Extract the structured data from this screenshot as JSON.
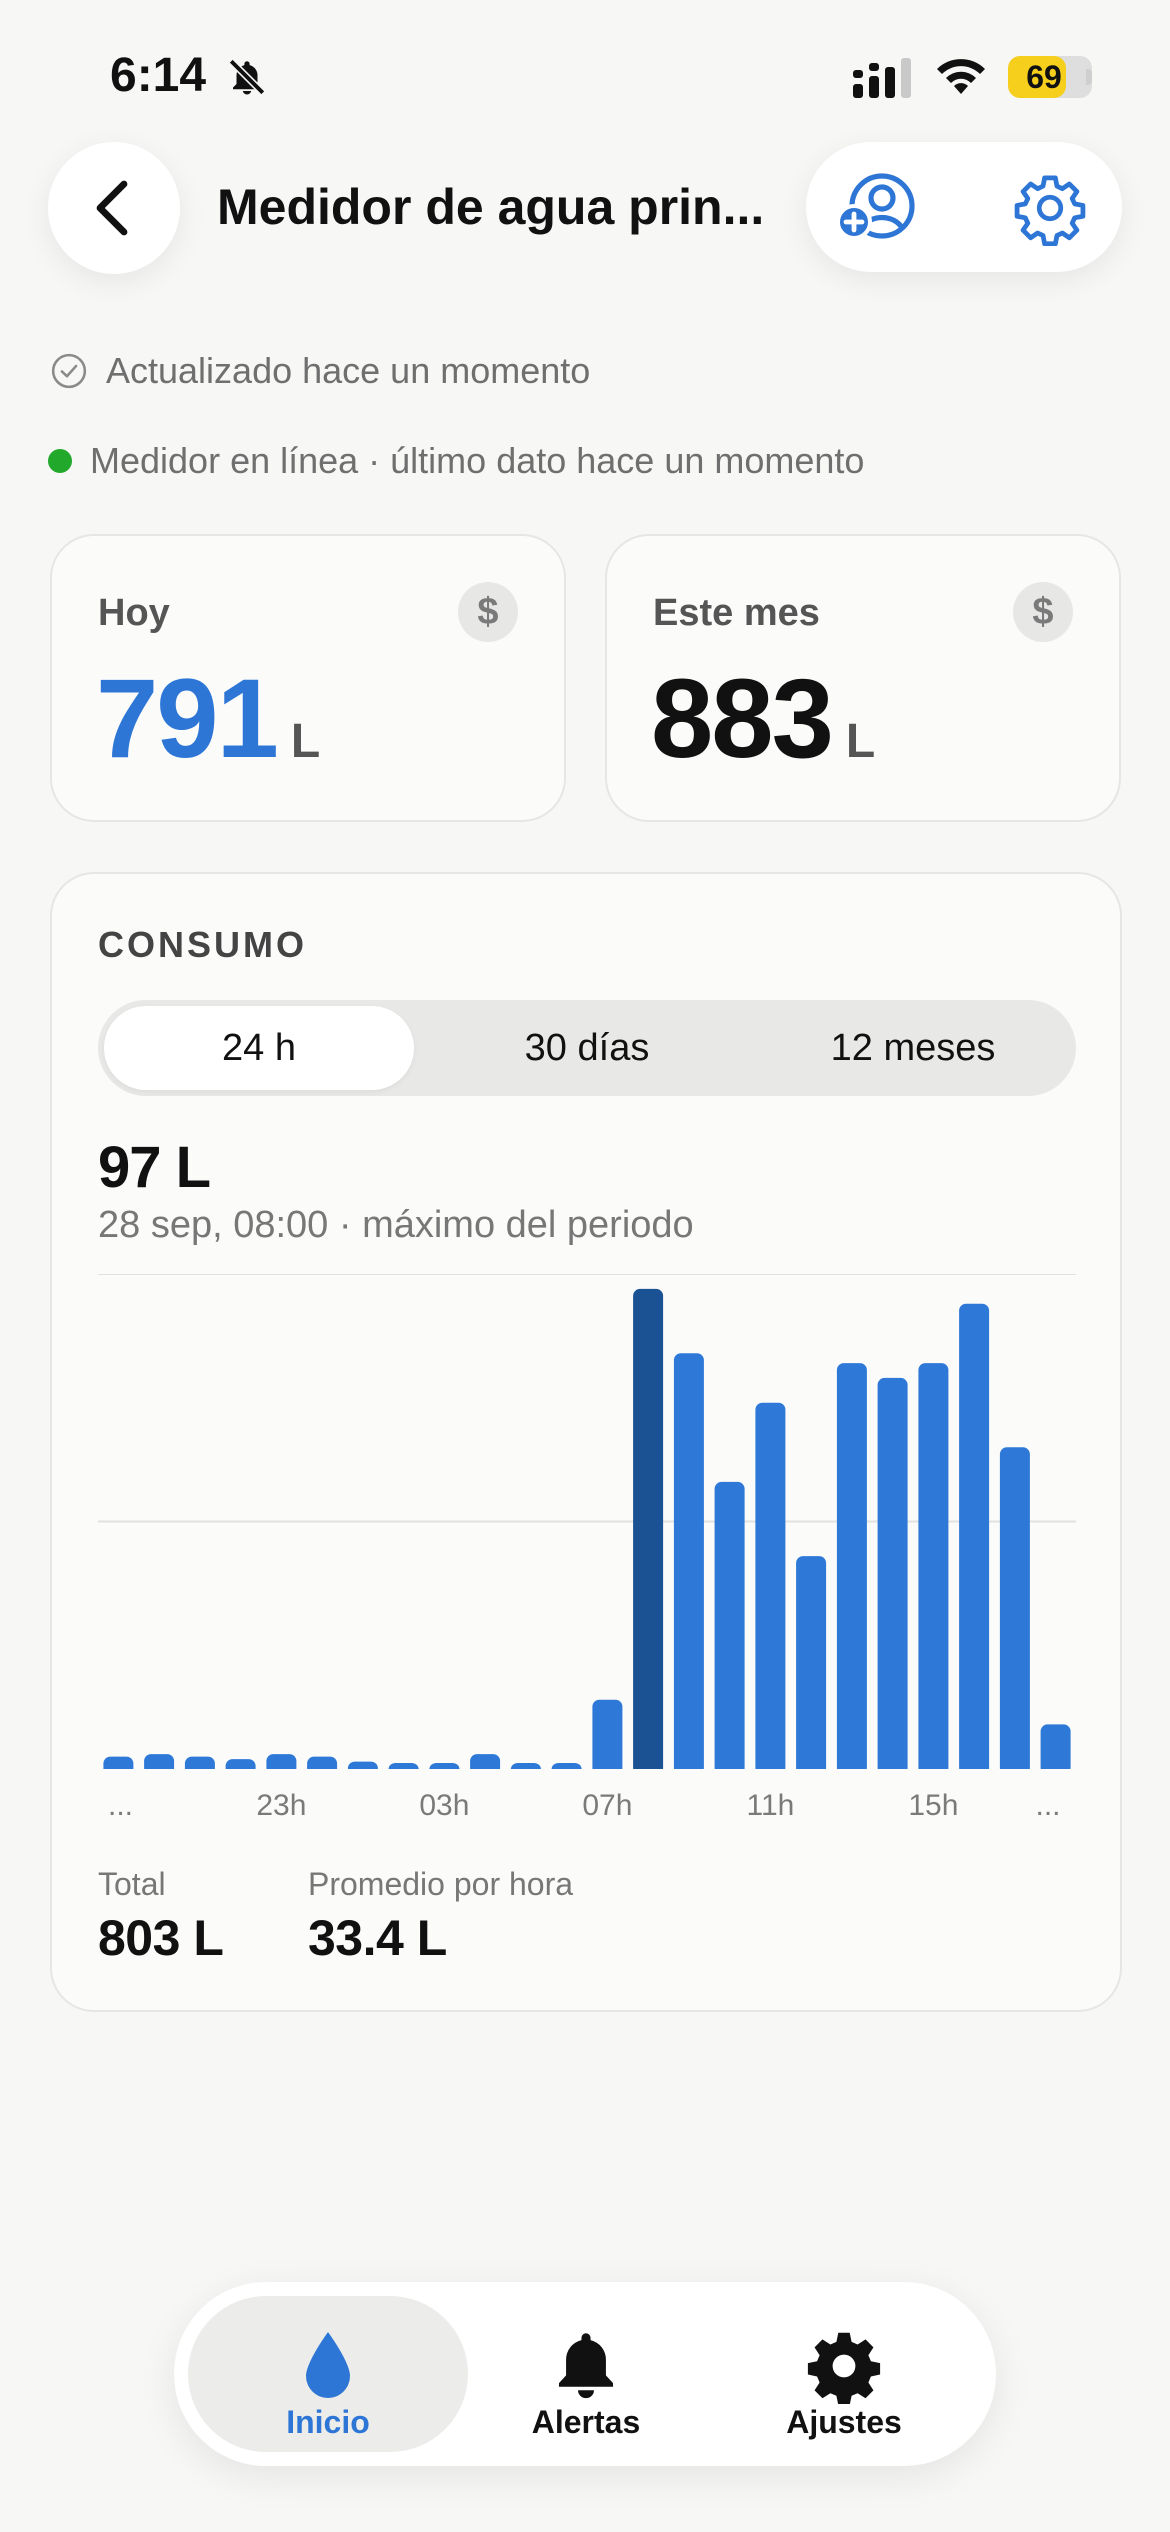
{
  "status_bar": {
    "time": "6:14",
    "battery": "69",
    "battery_level": 0.69
  },
  "header": {
    "title": "Medidor de agua prin..."
  },
  "status": {
    "updated": "Actualizado hace un momento",
    "online": "Medidor en línea · último dato hace un momento",
    "online_color": "#22a82a"
  },
  "stats": {
    "today": {
      "label": "Hoy",
      "value": "791",
      "unit": "L",
      "currency_icon": "$"
    },
    "month": {
      "label": "Este mes",
      "value": "883",
      "unit": "L",
      "currency_icon": "$"
    }
  },
  "consumo": {
    "title": "CONSUMO",
    "tabs": [
      "24 h",
      "30 días",
      "12 meses"
    ],
    "selected_tab": "24 h",
    "peak_value": "97 L",
    "peak_subtitle": "28 sep, 08:00 · máximo del periodo",
    "totals": [
      {
        "label": "Total",
        "value": "803 L"
      },
      {
        "label": "Promedio por hora",
        "value": "33.4 L"
      }
    ]
  },
  "chart_data": {
    "type": "bar",
    "categories": [
      "",
      "",
      "",
      "23h",
      "",
      "",
      "",
      "03h",
      "",
      "",
      "",
      "07h",
      "",
      "",
      "",
      "11h",
      "",
      "",
      "",
      "15h",
      "",
      "",
      "",
      ""
    ],
    "x_tick_labels": [
      "...",
      "23h",
      "03h",
      "07h",
      "11h",
      "15h",
      "..."
    ],
    "values": [
      2.5,
      3,
      2.5,
      2,
      3,
      2.5,
      1.5,
      0.5,
      0.5,
      3,
      1.2,
      1.2,
      14,
      97,
      84,
      58,
      74,
      43,
      82,
      79,
      82,
      94,
      65,
      9
    ],
    "highlight_index": 13,
    "ylim": [
      0,
      100
    ],
    "grid": true,
    "colors": {
      "bar": "#2e79d8",
      "highlight": "#1b5294"
    }
  },
  "tabbar": {
    "items": [
      {
        "label": "Inicio",
        "icon": "water-drop-icon",
        "active": true
      },
      {
        "label": "Alertas",
        "icon": "bell-icon",
        "active": false
      },
      {
        "label": "Ajustes",
        "icon": "gear-icon",
        "active": false
      }
    ],
    "accent": "#2d76d6"
  }
}
